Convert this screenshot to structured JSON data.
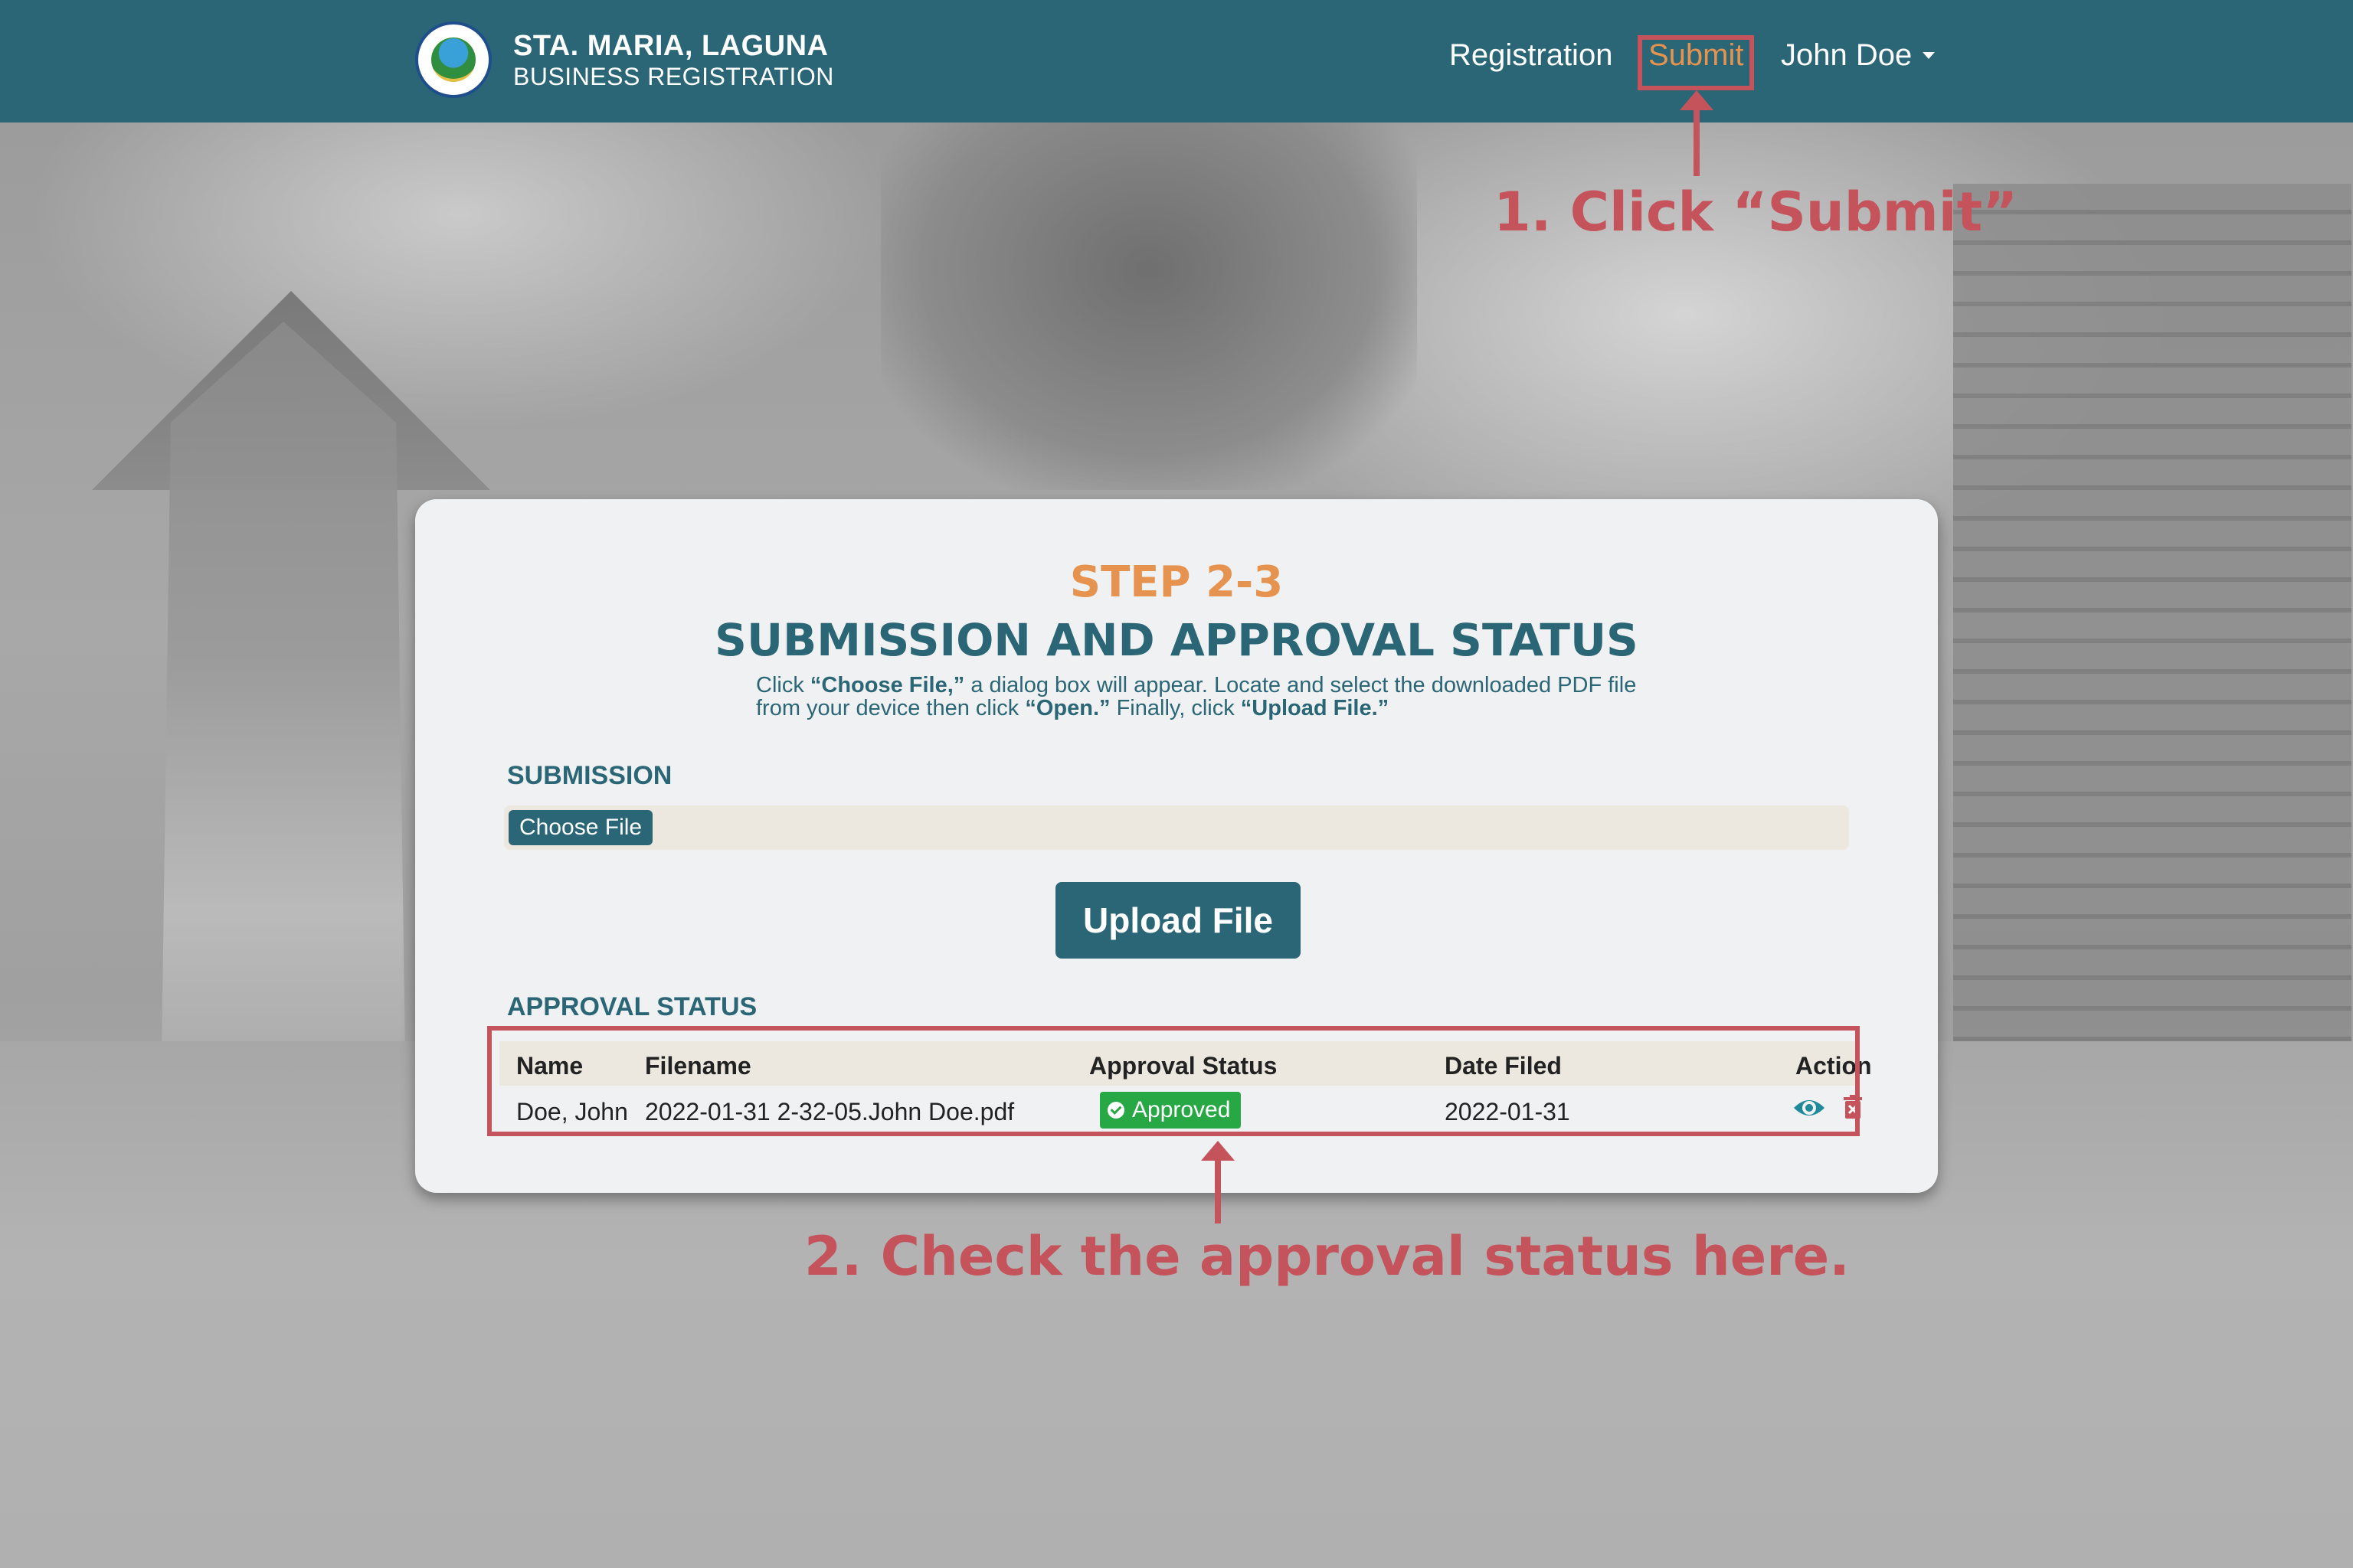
{
  "header": {
    "title": "STA. MARIA, LAGUNA",
    "subtitle": "BUSINESS REGISTRATION",
    "nav": {
      "registration": "Registration",
      "submit": "Submit",
      "user": "John Doe"
    }
  },
  "annotations": {
    "step1": "1. Click “Submit”",
    "step2": "2. Check the approval status here."
  },
  "card": {
    "step": "STEP 2-3",
    "heading": "SUBMISSION AND APPROVAL STATUS",
    "instructions": {
      "t1": "Click ",
      "b1": "“Choose File,”",
      "t2": " a dialog box will appear. Locate and select the downloaded PDF file from your device then click ",
      "b2": "“Open.”",
      "t3": " Finally, click ",
      "b3": "“Upload File.”"
    },
    "submission_label": "SUBMISSION",
    "choose_file": "Choose File",
    "upload_button": "Upload File",
    "approval_label": "APPROVAL STATUS",
    "table": {
      "headers": [
        "Name",
        "Filename",
        "Approval Status",
        "Date Filed",
        "Action"
      ],
      "rows": [
        {
          "name": "Doe, John",
          "filename": "2022-01-31 2-32-05.John Doe.pdf",
          "status": "Approved",
          "date": "2022-01-31"
        }
      ]
    }
  },
  "colors": {
    "navbar": "#2b6676",
    "accent_orange": "#e5934f",
    "annotation_red": "#c4535b",
    "approved_green": "#28a745"
  },
  "icons": [
    "eye-icon",
    "trash-icon",
    "check-circle-icon",
    "caret-down-icon"
  ]
}
